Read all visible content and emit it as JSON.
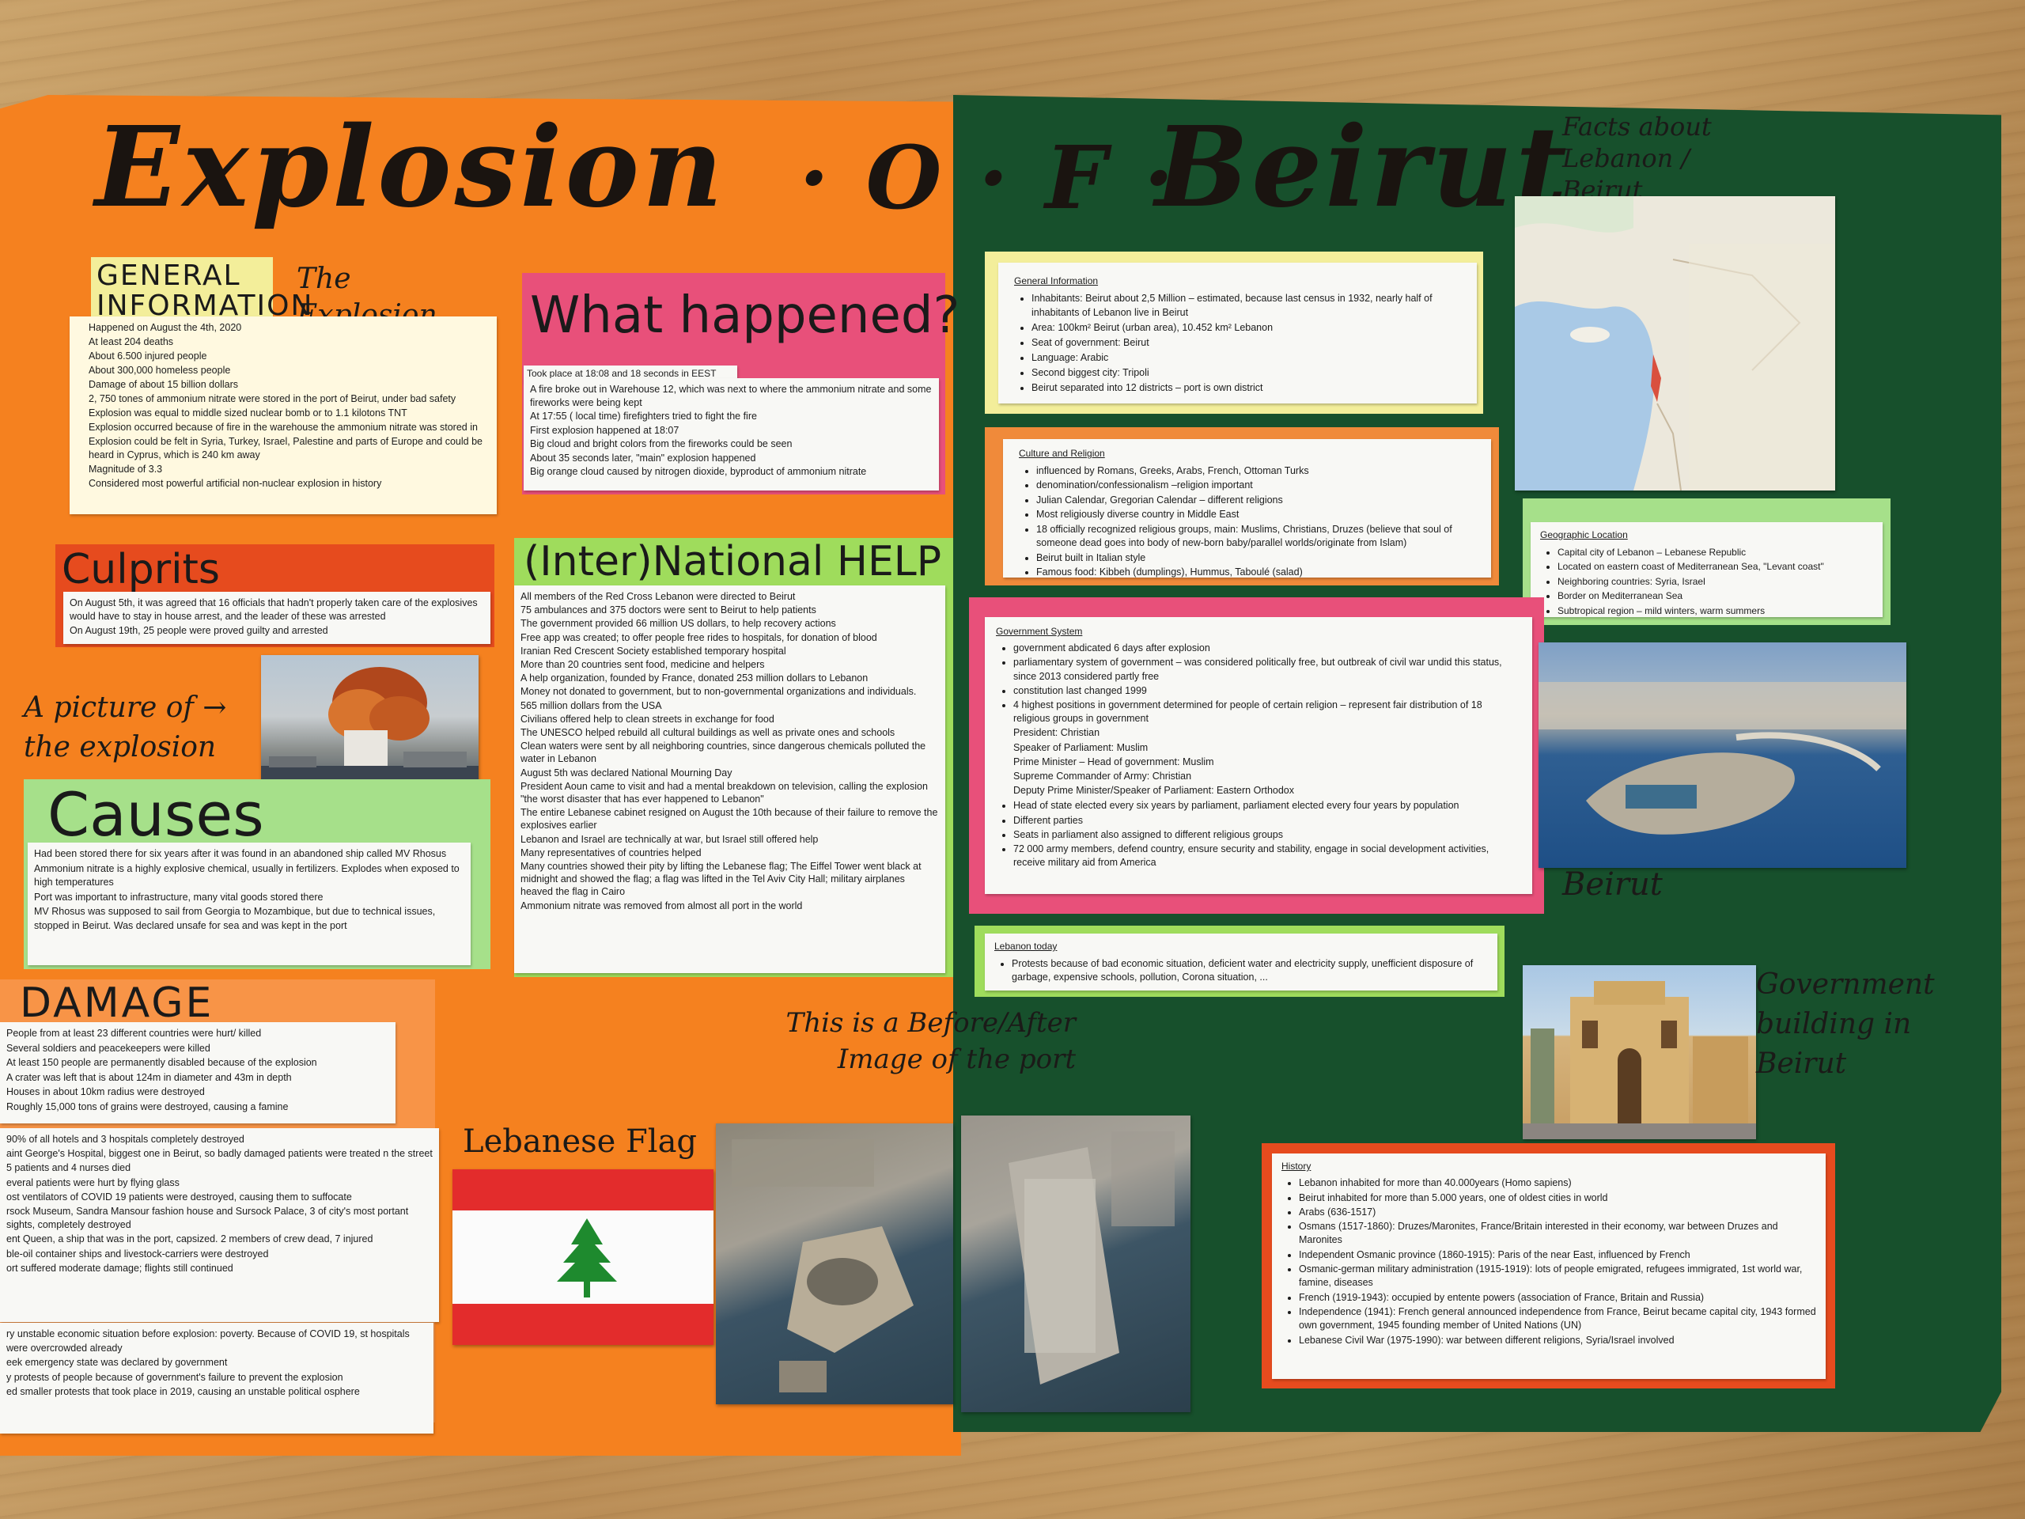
{
  "colors": {
    "orange_board": "#f5811f",
    "green_board": "#17502c",
    "pink": "#e8507a",
    "red_orange": "#e64b1e",
    "light_green": "#9fdc5c",
    "yellow": "#f3ee9a",
    "green_card": "#a6e08a"
  },
  "title": {
    "word1": "Explosion",
    "word2": "· O · F ·",
    "word3": "Beirut"
  },
  "facts_note": "Facts about Lebanon / Beirut",
  "general_information": {
    "heading": "GENERAL INFORMATION",
    "aside": "The Explosion",
    "lines": [
      "Happened on August the 4th, 2020",
      "At least 204 deaths",
      "About 6.500 injured people",
      "About 300,000 homeless people",
      "Damage of about 15 billion dollars",
      "2, 750 tones of ammonium nitrate were stored in the port of Beirut, under bad safety",
      "Explosion was equal to middle sized nuclear bomb or to 1.1 kilotons TNT",
      "Explosion occurred because of fire in the warehouse the ammonium nitrate was stored in",
      "Explosion could be felt in Syria, Turkey, Israel, Palestine and parts of Europe and could be heard in Cyprus, which is 240 km away",
      "Magnitude of 3.3",
      "Considered most powerful artificial non-nuclear explosion in history"
    ]
  },
  "what_happened": {
    "heading": "What happened?",
    "time": "Took place at 18:08 and 18 seconds in EEST",
    "lines": [
      "A fire broke out in Warehouse 12, which was next to where the ammonium nitrate and some fireworks were being kept",
      "At 17:55 ( local time) firefighters tried to fight the fire",
      "First explosion happened at 18:07",
      "Big cloud and bright colors from the fireworks could be seen",
      "About 35 seconds later, \"main\" explosion happened",
      "Big orange cloud caused by nitrogen dioxide, byproduct of ammonium nitrate"
    ]
  },
  "culprits": {
    "heading": "Culprits",
    "lines": [
      "On August 5th, it was agreed that 16 officials that hadn't properly taken care of the explosives would have to stay in house arrest, and the leader of these was arrested",
      "On August 19th, 25 people were proved guilty and arrested"
    ]
  },
  "picture_note": "A picture of → the explosion",
  "causes": {
    "heading": "Causes",
    "lines": [
      "Had been stored there for six years after it was found in an abandoned ship called MV Rhosus",
      "Ammonium nitrate is a highly explosive chemical, usually in fertilizers. Explodes when exposed to high temperatures",
      "Port was important to infrastructure, many vital goods stored there",
      "MV Rhosus was supposed to sail from Georgia to Mozambique, but due to technical issues, stopped in Beirut. Was declared unsafe for sea and was kept in the port"
    ]
  },
  "international_help": {
    "heading": "(Inter)National HELP",
    "lines": [
      "All members of the Red Cross Lebanon were directed to Beirut",
      "75 ambulances and 375 doctors were sent to Beirut to help patients",
      "The government provided 66 million US dollars, to help recovery actions",
      "Free app was created; to offer people free rides to hospitals, for donation of blood",
      "Iranian Red Crescent Society established temporary hospital",
      "More than 20 countries sent food, medicine and helpers",
      "A help organization, founded by France, donated 253 million dollars to Lebanon",
      "Money not donated to government, but to non-governmental organizations and individuals.",
      "565 million dollars from the USA",
      "Civilians offered help to clean streets in exchange for food",
      "The UNESCO helped rebuild all cultural buildings as well as private ones and schools",
      "Clean waters were sent by all neighboring countries, since dangerous chemicals polluted the water in Lebanon",
      "August 5th was declared National Mourning Day",
      "President Aoun came to visit and had a mental breakdown on television, calling the explosion \"the worst disaster that has ever happened to Lebanon\"",
      "The entire Lebanese cabinet resigned on August the 10th because of their failure to remove the explosives earlier",
      "Lebanon and Israel are technically at war, but Israel still offered help",
      "Many representatives of countries helped",
      "Many countries showed their pity by lifting the Lebanese flag; The Eiffel Tower went black at midnight and showed the flag; a flag was lifted in the Tel Aviv City Hall; military airplanes heaved the flag in Cairo",
      "Ammonium nitrate was removed from almost all port in the world"
    ]
  },
  "damage": {
    "heading": "DAMAGE",
    "lines_a": [
      "People from at least 23 different countries were hurt/ killed",
      "Several soldiers and peacekeepers were killed",
      "At least 150 people are permanently disabled because of the explosion",
      "A crater was left that is about 124m in diameter and 43m in depth",
      "Houses in about 10km radius were destroyed",
      "Roughly 15,000 tons of grains were destroyed, causing a famine"
    ],
    "lines_b": [
      "90% of all hotels and 3 hospitals completely destroyed",
      "aint George's Hospital, biggest one in Beirut, so badly damaged patients were treated n the street",
      "5 patients and 4 nurses died",
      "everal patients were hurt by flying glass",
      "ost ventilators of COVID 19 patients were destroyed, causing them to suffocate",
      "rsock Museum, Sandra Mansour fashion house and Sursock Palace, 3 of city's most portant sights, completely destroyed",
      "ent Queen, a ship that was in the port, capsized. 2 members of crew dead, 7 injured",
      "ble-oil container ships and livestock-carriers were destroyed",
      "ort suffered moderate damage; flights still continued"
    ],
    "lines_c": [
      "ry unstable economic situation before explosion: poverty. Because of COVID 19, st hospitals were overcrowded already",
      "eek emergency state was declared by government",
      "y protests of people because of government's failure to prevent the explosion",
      "ed smaller protests that took place in 2019, causing an unstable political osphere"
    ]
  },
  "flag_label": "Lebanese Flag",
  "before_after_note": "This is a Before/After Image of the port",
  "general_info_right": {
    "title": "General Information",
    "items": [
      "Inhabitants: Beirut about 2,5 Million – estimated, because last census in 1932, nearly half of inhabitants of Lebanon live in Beirut",
      "Area: 100km² Beirut (urban area), 10.452 km² Lebanon",
      "Seat of government: Beirut",
      "Language: Arabic",
      "Second biggest city: Tripoli",
      "Beirut separated into 12 districts – port is own district"
    ]
  },
  "culture_religion": {
    "title": "Culture and Religion",
    "items": [
      "influenced by Romans, Greeks, Arabs, French, Ottoman Turks",
      "denomination/confessionalism –religion important",
      "Julian Calendar, Gregorian Calendar – different religions",
      "Most religiously diverse country in Middle East",
      "18 officially recognized religious groups, main: Muslims, Christians, Druzes (believe that soul of someone dead goes into body of new-born baby/parallel worlds/originate from Islam)",
      "Beirut built in Italian style",
      "Famous food: Kibbeh (dumplings), Hummus, Taboulé (salad)"
    ]
  },
  "geographic_location": {
    "title": "Geographic Location",
    "items": [
      "Capital city of Lebanon – Lebanese Republic",
      "Located on eastern coast of Mediterranean Sea, \"Levant coast\"",
      "Neighboring countries: Syria, Israel",
      "Border on Mediterranean Sea",
      "Subtropical region – mild winters, warm summers"
    ]
  },
  "government_system": {
    "title": "Government System",
    "items": [
      "government abdicated 6 days after explosion",
      "parliamentary system of government – was considered politically free, but outbreak of civil war undid this status, since 2013 considered partly free",
      "constitution last changed 1999",
      "4 highest positions in government determined for people of certain religion – represent fair distribution of 18 religious groups in government",
      "Head of state elected every six years by parliament, parliament elected every four years by population",
      "Different parties",
      "Seats in parliament also assigned to different religious groups",
      "72 000 army members, defend country, ensure security and stability, engage in social development activities, receive military aid from America"
    ],
    "positions": [
      "President: Christian",
      "Speaker of Parliament: Muslim",
      "Prime Minister – Head of government: Muslim",
      "Supreme Commander of Army: Christian",
      "Deputy Prime Minister/Speaker of Parliament: Eastern Orthodox"
    ]
  },
  "lebanon_today": {
    "title": "Lebanon today",
    "items": [
      "Protests because of bad economic situation, deficient water and electricity supply, unefficient disposure of garbage, expensive schools, pollution, Corona situation, ..."
    ]
  },
  "beirut_label": "Beirut",
  "government_building_label": "Government building in Beirut",
  "history": {
    "title": "History",
    "items": [
      "Lebanon inhabited for more than 40.000years (Homo sapiens)",
      "Beirut inhabited for more than 5.000 years, one of oldest cities in world",
      "Arabs (636-1517)",
      "Osmans (1517-1860): Druzes/Maronites, France/Britain interested in their economy, war between Druzes and Maronites",
      "Independent Osmanic province (1860-1915): Paris of the near East, influenced by French",
      "Osmanic-german military administration (1915-1919): lots of people emigrated, refugees immigrated, 1st world war, famine, diseases",
      "French (1919-1943): occupied by entente powers (association of France, Britain and Russia)",
      "Independence (1941): French general announced independence from France, Beirut became capital city, 1943 formed own government, 1945 founding member of United Nations (UN)",
      "Lebanese Civil War (1975-1990): war between different religions, Syria/Israel involved"
    ]
  }
}
